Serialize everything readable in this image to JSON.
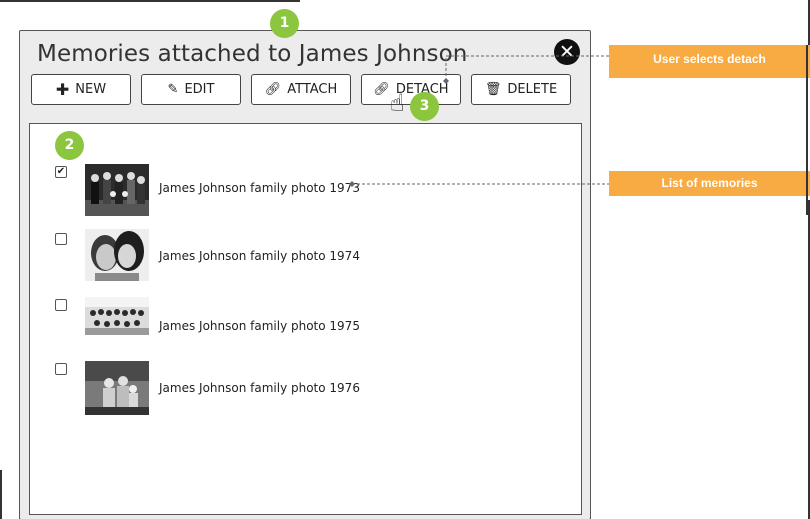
{
  "dialog": {
    "title": "Memories attached to James Johnson",
    "close_icon": "close-icon"
  },
  "toolbar": {
    "new_label": "NEW",
    "edit_label": "EDIT",
    "attach_label": "ATTACH",
    "detach_label": "DETACH",
    "delete_label": "DELETE",
    "icons": [
      "plus-icon",
      "pencil-icon",
      "link-icon",
      "link-icon",
      "trash-icon"
    ]
  },
  "memories": [
    {
      "label": "James Johnson family photo 1973",
      "checked": true
    },
    {
      "label": "James Johnson family photo 1974",
      "checked": false
    },
    {
      "label": "James Johnson family photo 1975",
      "checked": false
    },
    {
      "label": "James Johnson family photo 1976",
      "checked": false
    }
  ],
  "badges": {
    "b1": "1",
    "b2": "2",
    "b3": "3"
  },
  "callouts": {
    "detach": "User selects detach",
    "list": "List of memories"
  },
  "colors": {
    "badge": "#8cc63f",
    "callout": "#f7ab42",
    "dialog_bg": "#ececec"
  }
}
